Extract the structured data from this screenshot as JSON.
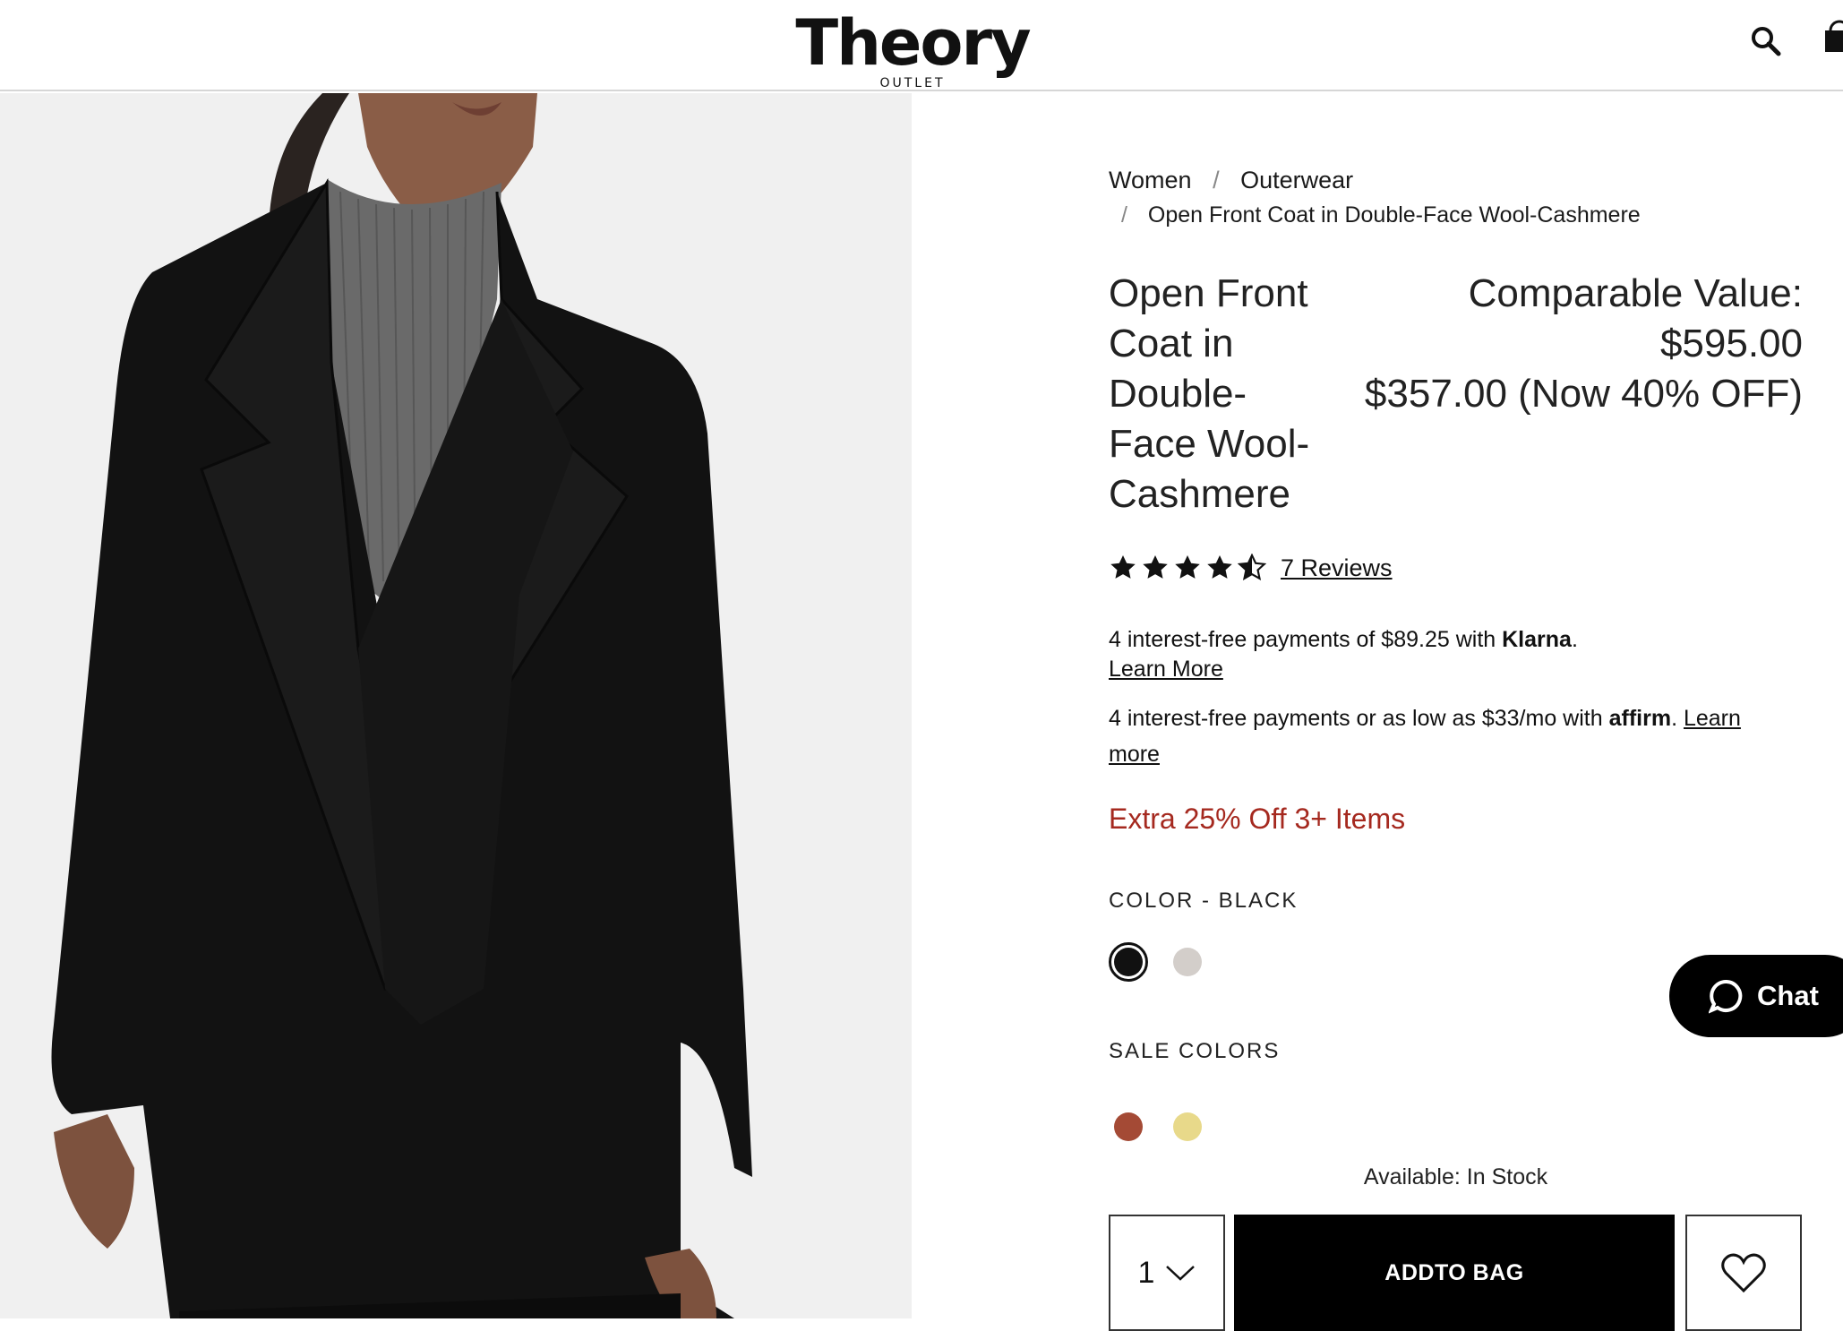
{
  "header": {
    "logo_main": "Theory",
    "logo_sub": "OUTLET",
    "icons": [
      "search-icon",
      "shopping-bag-icon"
    ]
  },
  "breadcrumb": {
    "items": [
      "Women",
      "Outerwear",
      "Open Front Coat in Double-Face Wool-Cashmere"
    ],
    "separator": "/"
  },
  "product": {
    "title_lines": [
      "Open Front",
      "Coat in",
      "Double-",
      "Face Wool-",
      "Cashmere"
    ],
    "comparable_value": "Comparable Value: $595.00",
    "sale_price": "$357.00 (Now 40% OFF)",
    "rating": 4.5,
    "reviews_link": "7 Reviews"
  },
  "klarna": {
    "text": "4 interest-free payments of $89.25 with ",
    "brand": "Klarna",
    "suffix": ".",
    "link": "Learn More"
  },
  "affirm": {
    "text": "4 interest-free payments or as low as $33/mo with ",
    "brand": "affirm",
    "suffix": ". ",
    "link_part1": "Learn",
    "link_part2": "more"
  },
  "promo": "Extra 25% Off 3+ Items",
  "colors": {
    "label": "COLOR -  BLACK",
    "swatches": [
      {
        "name": "black",
        "hex": "#111111",
        "selected": true
      },
      {
        "name": "grey",
        "hex": "#d3ceca",
        "selected": false
      }
    ]
  },
  "sale_colors": {
    "label": "SALE COLORS",
    "swatches": [
      {
        "name": "rust",
        "hex": "#a44a35"
      },
      {
        "name": "yellow",
        "hex": "#e8d98a"
      }
    ]
  },
  "availability": "Available: In Stock",
  "purchase": {
    "quantity": "1",
    "add_to_bag": "ADDTO BAG"
  },
  "chat": {
    "label": "Chat"
  }
}
